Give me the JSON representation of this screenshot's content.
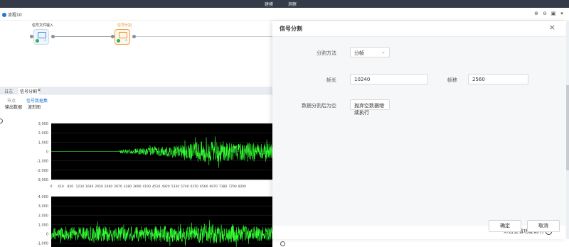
{
  "topbar": {
    "tabs": [
      "建模",
      "洞察"
    ]
  },
  "flow": {
    "title": "流程10"
  },
  "canvas": {
    "nodes": [
      {
        "label": "信号文件输入"
      },
      {
        "label": "信号分割"
      }
    ]
  },
  "panel": {
    "tabs": [
      "日志",
      "信号分割"
    ],
    "subtabs_top": [
      "节点",
      "信号数据集"
    ],
    "subtabs_bottom": [
      "输出数据",
      "波形图"
    ]
  },
  "chart_data": [
    {
      "type": "line",
      "background": "#000000",
      "series_color": "#33ff33",
      "y_ticks": [
        "3,000",
        "2,000",
        "1,000",
        "0",
        "-1,000",
        "-2,000",
        "-3,000"
      ],
      "ylim": [
        -3000,
        3000
      ],
      "x_ticks": [
        "0",
        "410",
        "820",
        "1230",
        "1640",
        "2050",
        "2460",
        "2870",
        "3280",
        "3690",
        "4100",
        "4510",
        "4920",
        "5330",
        "5740",
        "6150",
        "6560",
        "6970",
        "7380",
        "7790",
        "8200"
      ],
      "envelope": [
        [
          0,
          0
        ],
        [
          2870,
          0
        ],
        [
          3000,
          300
        ],
        [
          3690,
          500
        ],
        [
          4100,
          700
        ],
        [
          4920,
          900
        ],
        [
          5740,
          1300
        ],
        [
          6150,
          1600
        ],
        [
          6560,
          2200
        ],
        [
          6970,
          1700
        ],
        [
          7380,
          2000
        ],
        [
          7790,
          1400
        ],
        [
          8200,
          1600
        ],
        [
          9500,
          1400
        ]
      ]
    },
    {
      "type": "line",
      "background": "#000000",
      "series_color": "#33ff33",
      "y_ticks": [
        "4,000",
        "3,000",
        "2,000",
        "1,000",
        "0",
        "-1,000"
      ],
      "ylim": [
        -1400,
        4000
      ],
      "envelope": [
        [
          0,
          1000
        ],
        [
          2000,
          1400
        ],
        [
          3000,
          1300
        ],
        [
          4500,
          1500
        ],
        [
          6000,
          1400
        ],
        [
          7000,
          1800
        ],
        [
          8000,
          1500
        ],
        [
          9500,
          1200
        ]
      ]
    }
  ],
  "dialog": {
    "title": "信号分割",
    "close_icon": "×",
    "fields": {
      "split_method_label": "分割方法",
      "split_method_value": "分帧",
      "frame_length_label": "帧长",
      "frame_length_value": "10240",
      "frame_shift_label": "帧移",
      "frame_shift_value": "2560",
      "empty_data_label": "数据分割后为空",
      "empty_data_value": "抛弃空数据继续执行"
    },
    "help_link": "点击查看功能说明",
    "help_icon": "›",
    "confirm_label": "确定",
    "cancel_label": "取消"
  }
}
